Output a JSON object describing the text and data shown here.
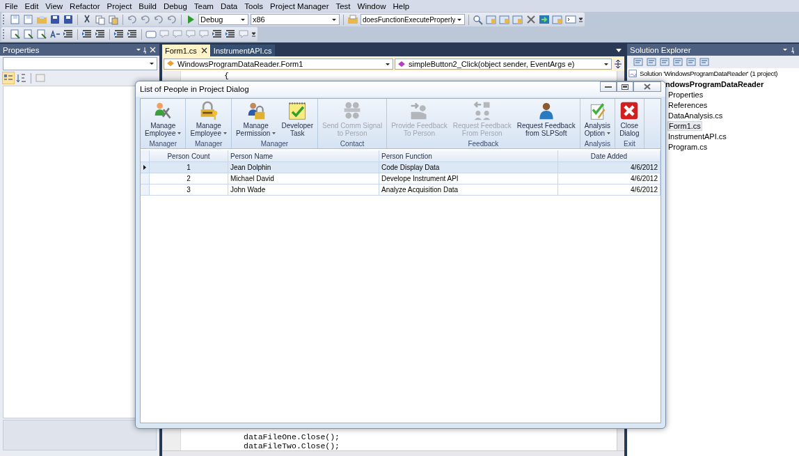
{
  "menu": [
    "File",
    "Edit",
    "View",
    "Refactor",
    "Project",
    "Build",
    "Debug",
    "Team",
    "Data",
    "Tools",
    "Project Manager",
    "Test",
    "Window",
    "Help"
  ],
  "toolbar": {
    "configuration": "Debug",
    "platform": "x86",
    "find": "doesFunctionExecuteProperly"
  },
  "properties_panel": {
    "title": "Properties"
  },
  "editor": {
    "tabs": [
      {
        "label": "Form1.cs",
        "selected": true
      },
      {
        "label": "InstrumentAPI.cs",
        "selected": false
      }
    ],
    "type_combo": "WindowsProgramDataReader.Form1",
    "member_combo": "simpleButton2_Click(object sender, EventArgs e)",
    "code_top": [
      "{"
    ],
    "code_bottom": [
      "dataFileOne.Close();",
      "dataFileTwo.Close();"
    ]
  },
  "solution_explorer": {
    "title": "Solution Explorer",
    "tree": [
      {
        "label": "Solution 'WindowsProgramDataReader' (1 project)",
        "selected": false,
        "children": [
          {
            "label": "ndowsProgramDataReader",
            "selected": false,
            "children": [
              {
                "label": "Properties",
                "selected": false
              },
              {
                "label": "References",
                "selected": false
              },
              {
                "label": "DataAnalysis.cs",
                "selected": false
              },
              {
                "label": "Form1.cs",
                "selected": true
              },
              {
                "label": "InstrumentAPI.cs",
                "selected": false
              },
              {
                "label": "Program.cs",
                "selected": false
              }
            ]
          }
        ]
      }
    ]
  },
  "dialog": {
    "title": "List of People in Project Dialog",
    "ribbon": [
      {
        "group": "Manager",
        "buttons": [
          {
            "label": "Manage",
            "label2": "Employee",
            "dropdown": true,
            "disabled": false
          }
        ]
      },
      {
        "group": "Manager",
        "buttons": [
          {
            "label": "Manage",
            "label2": "Employee",
            "dropdown": true,
            "disabled": false
          }
        ]
      },
      {
        "group": "Manager",
        "buttons": [
          {
            "label": "Manage",
            "label2": "Permission",
            "dropdown": true,
            "disabled": false
          },
          {
            "label": "Developer",
            "label2": "Task",
            "dropdown": false,
            "disabled": false
          }
        ]
      },
      {
        "group": "Contact",
        "buttons": [
          {
            "label": "Send Comm Signal",
            "label2": "to Person",
            "dropdown": false,
            "disabled": true
          }
        ]
      },
      {
        "group": "Feedback",
        "buttons": [
          {
            "label": "Provide Feedback",
            "label2": "To Person",
            "dropdown": false,
            "disabled": true
          },
          {
            "label": "Request Feedback",
            "label2": "From Person",
            "dropdown": false,
            "disabled": true
          },
          {
            "label": "Request Feedback",
            "label2": "from SLPSoft",
            "dropdown": false,
            "disabled": false
          }
        ]
      },
      {
        "group": "Analysis",
        "buttons": [
          {
            "label": "Analysis",
            "label2": "Option",
            "dropdown": true,
            "disabled": false
          }
        ]
      },
      {
        "group": "Exit",
        "buttons": [
          {
            "label": "Close",
            "label2": "Dialog",
            "dropdown": false,
            "disabled": false
          }
        ]
      }
    ],
    "table": {
      "columns": [
        "Person Count",
        "Person Name",
        "Person Function",
        "Date Added"
      ],
      "rows": [
        {
          "cells": [
            "1",
            "Jean Dolphin",
            "Code Display Data",
            "4/6/2012"
          ],
          "selected": true
        },
        {
          "cells": [
            "2",
            "Michael David",
            "Develope Instrument API",
            "4/6/2012"
          ],
          "selected": false
        },
        {
          "cells": [
            "3",
            "John Wade",
            "Analyze Acquisition Data",
            "4/6/2012"
          ],
          "selected": false
        }
      ]
    }
  }
}
